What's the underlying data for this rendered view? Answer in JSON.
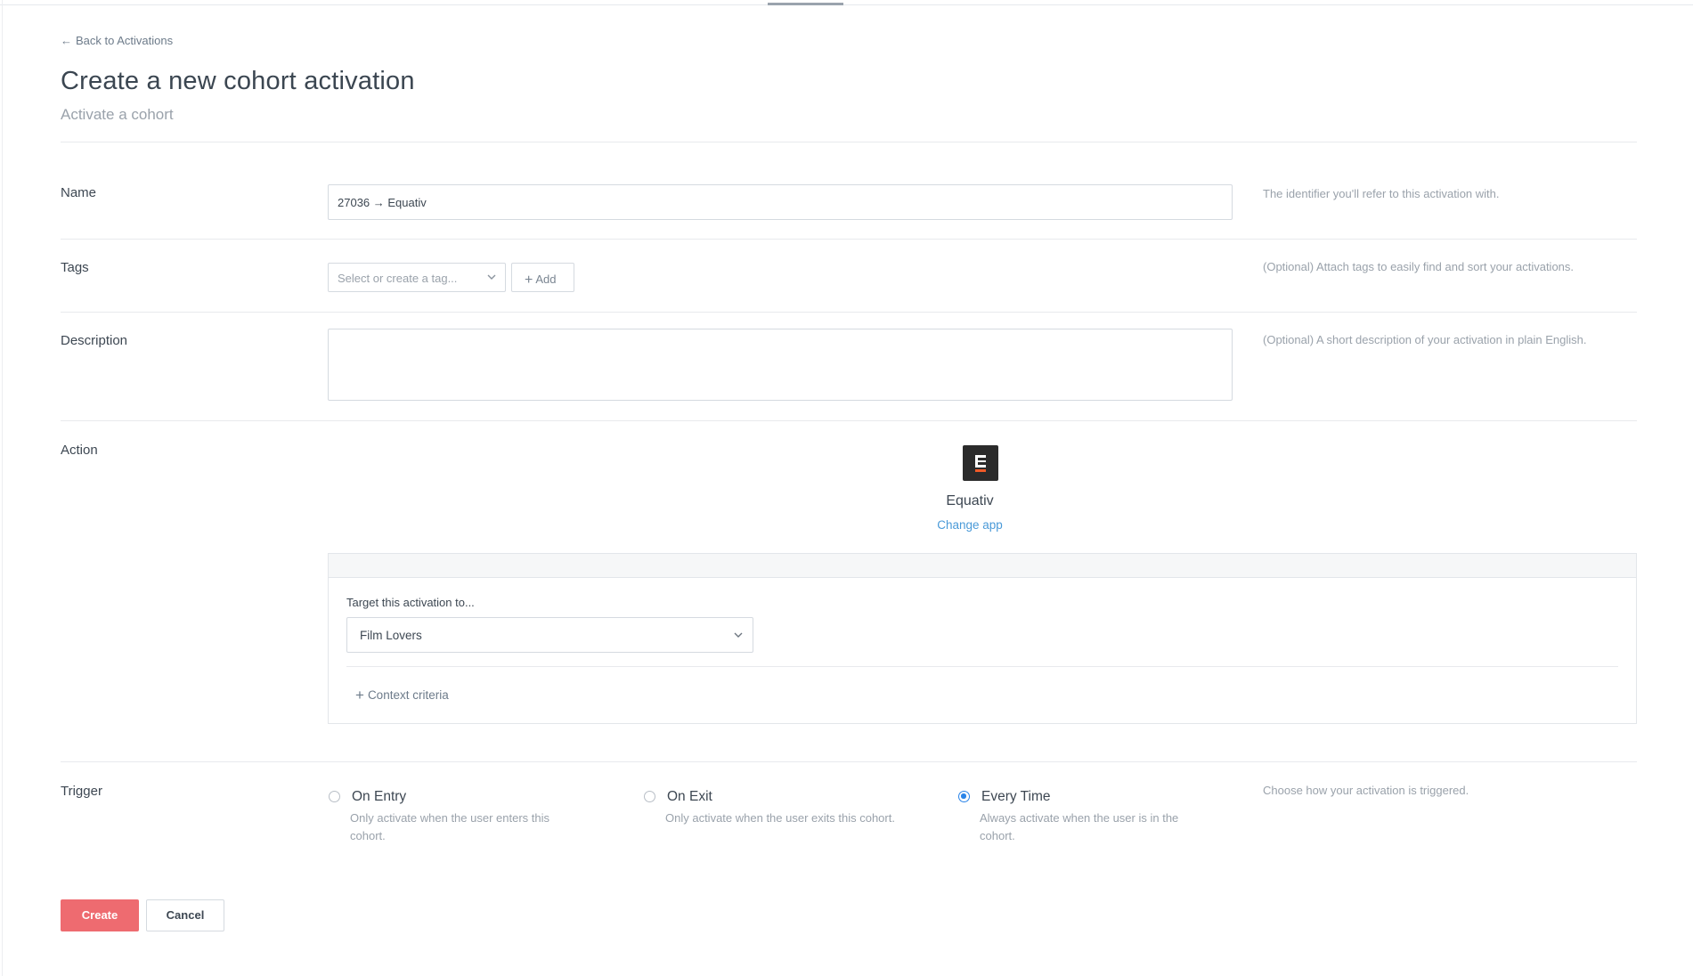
{
  "header": {
    "back_link": "Back to Activations",
    "title": "Create a new cohort activation",
    "subtitle": "Activate a cohort"
  },
  "fields": {
    "name": {
      "label": "Name",
      "value": "27036 → Equativ",
      "help": "The identifier you'll refer to this activation with."
    },
    "tags": {
      "label": "Tags",
      "placeholder": "Select or create a tag...",
      "add_label": "Add",
      "help": "(Optional) Attach tags to easily find and sort your activations."
    },
    "description": {
      "label": "Description",
      "value": "",
      "help": "(Optional) A short description of your activation in plain English."
    },
    "action": {
      "label": "Action",
      "app_name": "Equativ",
      "change_app": "Change app",
      "target_label": "Target this activation to...",
      "target_value": "Film Lovers",
      "context_criteria": "Context criteria",
      "logo_icon": "equativ-logo",
      "accent_color": "#f05a28"
    },
    "trigger": {
      "label": "Trigger",
      "help": "Choose how your activation is triggered.",
      "options": [
        {
          "title": "On Entry",
          "desc": "Only activate when the user enters this cohort.",
          "checked": false
        },
        {
          "title": "On Exit",
          "desc": "Only activate when the user exits this cohort.",
          "checked": false
        },
        {
          "title": "Every Time",
          "desc": "Always activate when the user is in the cohort.",
          "checked": true
        }
      ]
    }
  },
  "actions": {
    "create": "Create",
    "cancel": "Cancel",
    "create_color": "#ee6b70",
    "link_color": "#4a9ad8",
    "radio_color": "#2a84e8"
  }
}
